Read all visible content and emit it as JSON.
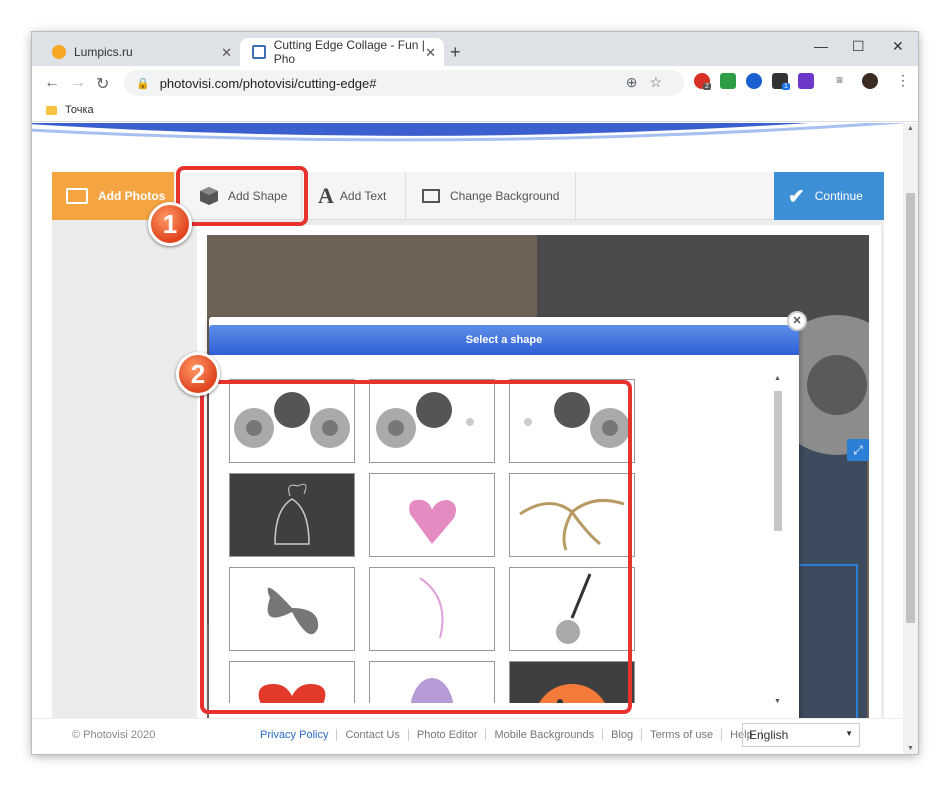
{
  "browser": {
    "tabs": [
      {
        "title": "Lumpics.ru",
        "close": "✕"
      },
      {
        "title": "Cutting Edge Collage - Fun | Pho",
        "close": "✕"
      }
    ],
    "new_tab": "+",
    "window_controls": {
      "minimize": "—",
      "maximize": "☐",
      "close": "✕"
    },
    "url": "photovisi.com/photovisi/cutting-edge#",
    "bookmarks": [
      {
        "label": "Точка"
      }
    ],
    "extension_badges": [
      "2",
      "1"
    ]
  },
  "app": {
    "toolbar": {
      "add_photos": "Add Photos",
      "add_shape": "Add Shape",
      "add_text": "Add Text",
      "text_icon": "A",
      "change_background": "Change Background",
      "continue": "Continue"
    },
    "dialog": {
      "title": "Select a shape",
      "close": "✕",
      "shapes": [
        {
          "name": "gears-1"
        },
        {
          "name": "gears-2"
        },
        {
          "name": "gears-3"
        },
        {
          "name": "bell"
        },
        {
          "name": "pink-heart"
        },
        {
          "name": "twine-bow"
        },
        {
          "name": "butterfly"
        },
        {
          "name": "pink-curve"
        },
        {
          "name": "guitar"
        },
        {
          "name": "red-heart"
        },
        {
          "name": "easter-egg"
        },
        {
          "name": "orange-ball"
        }
      ]
    }
  },
  "annotations": {
    "step1": "1",
    "step2": "2",
    "color": "#e8322e"
  },
  "footer": {
    "copyright": "© Photovisi 2020",
    "links": [
      "Privacy Policy",
      "Contact Us",
      "Photo Editor",
      "Mobile Backgrounds",
      "Blog",
      "Terms of use",
      "Help"
    ],
    "language": "English"
  },
  "colors": {
    "add_photos": "#f5a442",
    "continue": "#3d8fd6",
    "dialog_header": "#2e5ed6",
    "link": "#2b6cc4"
  }
}
